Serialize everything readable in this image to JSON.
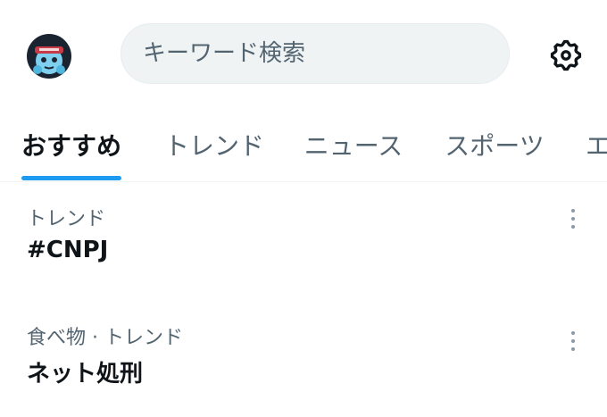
{
  "header": {
    "search_placeholder": "キーワード検索",
    "avatar_icon": "user-avatar",
    "settings_icon": "gear-icon"
  },
  "tabs": [
    {
      "label": "おすすめ",
      "active": true
    },
    {
      "label": "トレンド",
      "active": false
    },
    {
      "label": "ニュース",
      "active": false
    },
    {
      "label": "スポーツ",
      "active": false
    },
    {
      "label": "エ",
      "active": false
    }
  ],
  "trends": [
    {
      "context": "トレンド",
      "name": "#CNPJ"
    },
    {
      "context": "食べ物 · トレンド",
      "name": "ネット処刑"
    }
  ],
  "colors": {
    "accent": "#1d9bf0",
    "text_primary": "#0f1419",
    "text_secondary": "#536471",
    "search_bg": "#eff3f4"
  }
}
